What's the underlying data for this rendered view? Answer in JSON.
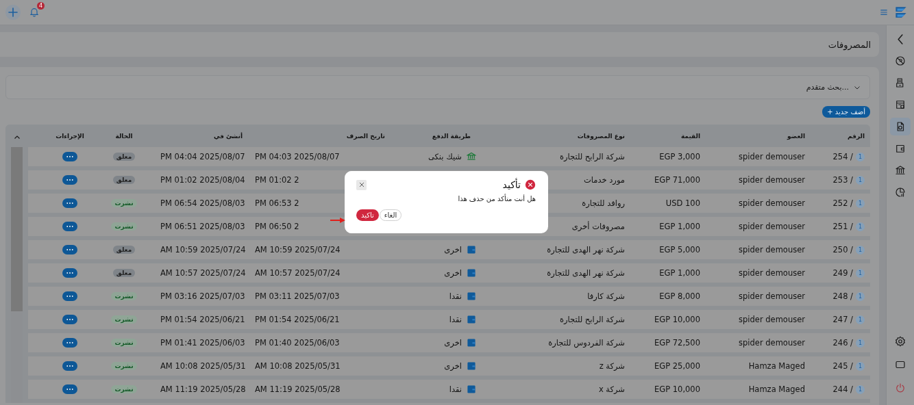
{
  "topbar": {
    "notifications": "4"
  },
  "sidebar": {
    "items": [
      {
        "kind": "back",
        "selected": false
      },
      {
        "kind": "blocked",
        "selected": false
      },
      {
        "kind": "receipt",
        "selected": false
      },
      {
        "kind": "calendar",
        "selected": false
      },
      {
        "kind": "document",
        "selected": true
      },
      {
        "kind": "wallet",
        "selected": false
      },
      {
        "kind": "bank",
        "selected": false
      },
      {
        "kind": "report",
        "selected": false
      }
    ],
    "bottom": [
      {
        "kind": "settings"
      },
      {
        "kind": "screen"
      },
      {
        "kind": "power"
      }
    ]
  },
  "page_title": "المصروفات",
  "advanced_search": "بحث متقدم...",
  "add_button": "+ أضف جديد",
  "table": {
    "columns": [
      "الرقم",
      "العضو",
      "القيمة",
      "نوع المصروفات",
      "طريقة الدفع",
      "تاريخ الصرف",
      "أنشئ في",
      "الحالة",
      "الإجراءات"
    ],
    "rows": [
      {
        "count": "1",
        "number": "254 /",
        "member": "spider demouser",
        "amount": "EGP 3,000",
        "type": "شركة الرابح للتجارة",
        "payment": {
          "kind": "bank",
          "label": "شيك بنكى"
        },
        "spent_at": "PM 04:03 2025/08/07",
        "created_at": "PM 04:04 2025/08/07",
        "status": {
          "kind": "pending",
          "label": "معلق"
        }
      },
      {
        "count": "1",
        "number": "253 /",
        "member": "spider demouser",
        "amount": "EGP 71,000",
        "type": "مورد خدمات",
        "spent_at": "PM 01:02 2",
        "created_at": "PM 01:02 2025/08/04",
        "status": {
          "kind": "pending",
          "label": "معلق"
        }
      },
      {
        "count": "1",
        "number": "252 /",
        "member": "spider demouser",
        "amount": "USD 100",
        "type": "روافد للتجارة",
        "spent_at": "PM 06:53 2",
        "created_at": "PM 06:54 2025/08/03",
        "status": {
          "kind": "published",
          "label": "نشرت"
        }
      },
      {
        "count": "1",
        "number": "251 /",
        "member": "spider demouser",
        "amount": "EGP 1,000",
        "type": "مصروفات أخرى",
        "spent_at": "PM 06:50 2",
        "created_at": "PM 06:51 2025/08/03",
        "status": {
          "kind": "published",
          "label": "نشرت"
        }
      },
      {
        "count": "1",
        "number": "250 /",
        "member": "spider demouser",
        "amount": "EGP 5,000",
        "type": "شركة  نهر الهدى للتجارة",
        "payment": {
          "kind": "wallet",
          "label": "اخرى"
        },
        "spent_at": "AM 10:59 2025/07/24",
        "created_at": "AM 10:59 2025/07/24",
        "status": {
          "kind": "pending",
          "label": "معلق"
        }
      },
      {
        "count": "1",
        "number": "249 /",
        "member": "spider demouser",
        "amount": "EGP 1,000",
        "type": "شركة  نهر الهدى للتجارة",
        "payment": {
          "kind": "wallet",
          "label": "اخرى"
        },
        "spent_at": "AM 10:57 2025/07/24",
        "created_at": "AM 10:57 2025/07/24",
        "status": {
          "kind": "pending",
          "label": "معلق"
        }
      },
      {
        "count": "1",
        "number": "248 /",
        "member": "spider demouser",
        "amount": "EGP 8,000",
        "type": "شركة كارفا",
        "payment": {
          "kind": "wallet",
          "label": "نقدا"
        },
        "spent_at": "PM 03:11 2025/07/03",
        "created_at": "PM 03:16 2025/07/03",
        "status": {
          "kind": "published",
          "label": "نشرت"
        }
      },
      {
        "count": "1",
        "number": "247 /",
        "member": "spider demouser",
        "amount": "EGP 10,000",
        "type": "شركة الرابح للتجارة",
        "payment": {
          "kind": "wallet",
          "label": "نقدا"
        },
        "spent_at": "PM 01:54 2025/06/21",
        "created_at": "PM 01:54 2025/06/21",
        "status": {
          "kind": "published",
          "label": "نشرت"
        }
      },
      {
        "count": "1",
        "number": "246 /",
        "member": "spider demouser",
        "amount": "EGP 72,500",
        "type": "شركة الفردوس للتجارة",
        "payment": {
          "kind": "wallet",
          "label": "اخرى"
        },
        "spent_at": "PM 01:40 2025/06/03",
        "created_at": "PM 01:41 2025/06/03",
        "status": {
          "kind": "published",
          "label": "نشرت"
        }
      },
      {
        "count": "1",
        "number": "245 /",
        "member": "Hamza Maged",
        "amount": "EGP 25,000",
        "type": "شركة z",
        "payment": {
          "kind": "wallet",
          "label": "اخرى"
        },
        "spent_at": "AM 10:08 2025/05/31",
        "created_at": "AM 10:08 2025/05/31",
        "status": {
          "kind": "published",
          "label": "نشرت"
        }
      },
      {
        "count": "1",
        "number": "244 /",
        "member": "Hamza Maged",
        "amount": "EGP 10,000",
        "type": "شركة x",
        "payment": {
          "kind": "wallet",
          "label": "نقدا"
        },
        "spent_at": "AM 11:19 2025/05/28",
        "created_at": "AM 11:19 2025/05/28",
        "status": {
          "kind": "published",
          "label": "نشرت"
        }
      }
    ]
  },
  "dialog": {
    "title": "تأكيد",
    "message": "هل أنت متأكد من حذف هذا",
    "cancel": "الغاء",
    "confirm": "تاكيد"
  }
}
